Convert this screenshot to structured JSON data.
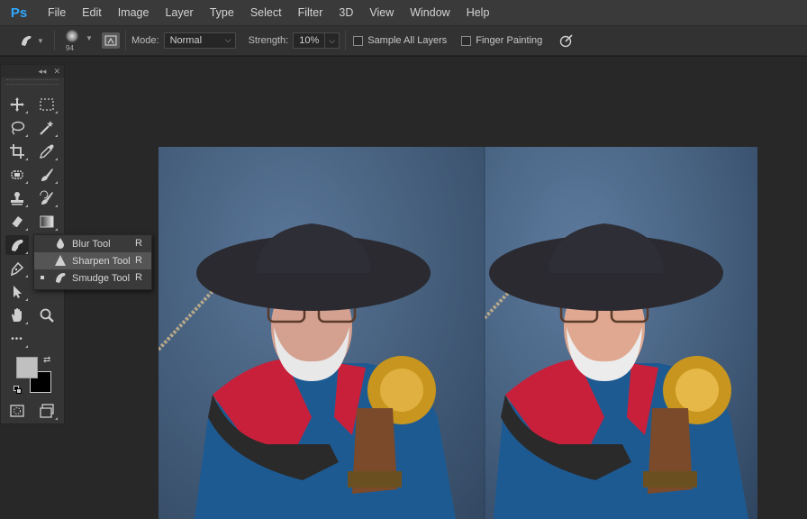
{
  "app": {
    "logo": "Ps"
  },
  "menu": [
    "File",
    "Edit",
    "Image",
    "Layer",
    "Type",
    "Select",
    "Filter",
    "3D",
    "View",
    "Window",
    "Help"
  ],
  "options": {
    "brush_size": "94",
    "mode_label": "Mode:",
    "mode_value": "Normal",
    "strength_label": "Strength:",
    "strength_value": "10%",
    "sample_all_layers": "Sample All Layers",
    "finger_painting": "Finger Painting"
  },
  "toolbox": {
    "more_tools": "•••"
  },
  "flyout": [
    {
      "label": "Blur Tool",
      "key": "R",
      "icon": "blur-drop-icon",
      "selected": false
    },
    {
      "label": "Sharpen Tool",
      "key": "R",
      "icon": "sharpen-triangle-icon",
      "selected": false
    },
    {
      "label": "Smudge Tool",
      "key": "R",
      "icon": "smudge-finger-icon",
      "selected": true
    }
  ],
  "colors": {
    "foreground": "#c0c0c0",
    "background": "#000000",
    "accent": "#31a8ff"
  }
}
